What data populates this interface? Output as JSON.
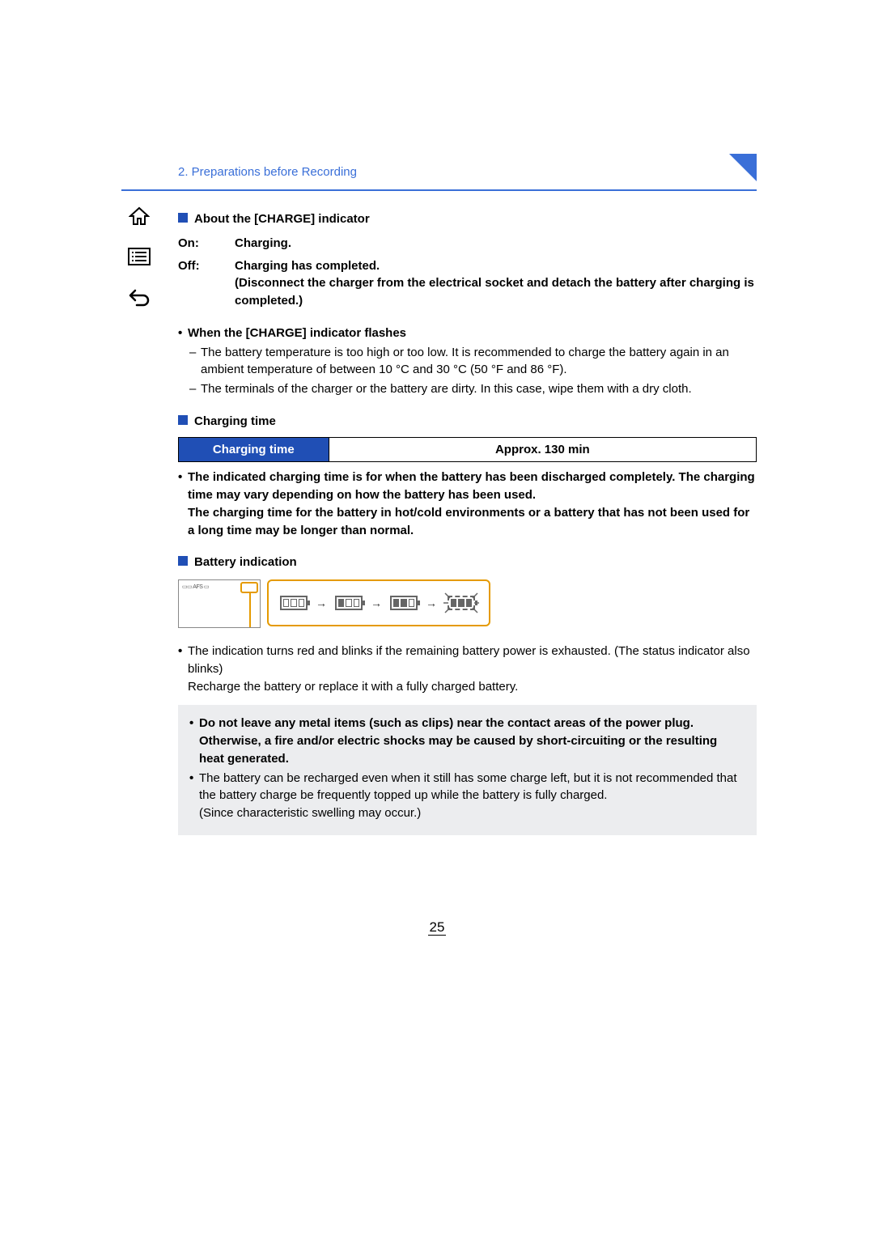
{
  "chapter": "2. Preparations before Recording",
  "sections": {
    "charge_indicator": {
      "title": "About the [CHARGE] indicator",
      "on_label": "On:",
      "on_value": "Charging.",
      "off_label": "Off:",
      "off_value": "Charging has completed.\n(Disconnect the charger from the electrical socket and detach the battery after charging is completed.)",
      "flash_title": "When the [CHARGE] indicator flashes",
      "flash_items": [
        "The battery temperature is too high or too low. It is recommended to charge the battery again in an ambient temperature of between 10 °C and 30 °C (50 °F and 86 °F).",
        "The terminals of the charger or the battery are dirty. In this case, wipe them with a dry cloth."
      ]
    },
    "charging_time": {
      "title": "Charging time",
      "table_header": "Charging time",
      "table_value": "Approx. 130 min",
      "notes": [
        "The indicated charging time is for when the battery has been discharged completely. The charging time may vary depending on how the battery has been used.",
        "The charging time for the battery in hot/cold environments or a battery that has not been used for a long time may be longer than normal."
      ]
    },
    "battery_indication": {
      "title": "Battery indication",
      "info": [
        "The indication turns red and blinks if the remaining battery power is exhausted. (The status indicator also blinks)",
        "Recharge the battery or replace it with a fully charged battery."
      ]
    },
    "warning_box": {
      "bold1": "Do not leave any metal items (such as clips) near the contact areas of the power plug. Otherwise, a fire and/or electric shocks may be caused by short-circuiting or the resulting heat generated.",
      "plain1": "The battery can be recharged even when it still has some charge left, but it is not recommended that the battery charge be frequently topped up while the battery is fully charged.",
      "plain2": "(Since characteristic swelling may occur.)"
    }
  },
  "page_number": "25",
  "icons": {
    "home": "home-icon",
    "toc": "list-icon",
    "back": "back-icon"
  }
}
